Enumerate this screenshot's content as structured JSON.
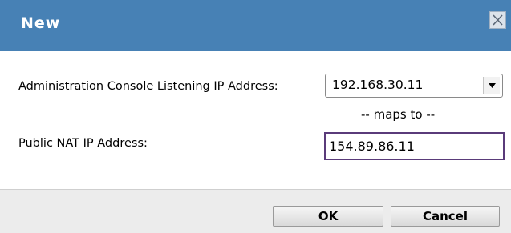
{
  "dialog": {
    "title": "New",
    "close_icon": "close-icon"
  },
  "form": {
    "admin_label": "Administration Console Listening IP Address:",
    "admin_select_value": "192.168.30.11",
    "maps_to_text": "-- maps to --",
    "public_label": "Public NAT IP Address:",
    "public_input_value": "154.89.86.11"
  },
  "footer": {
    "ok_label": "OK",
    "cancel_label": "Cancel"
  },
  "colors": {
    "titlebar": "#4781b5",
    "input_focus_border": "#5a3b7a",
    "footer_bg": "#ececec"
  }
}
